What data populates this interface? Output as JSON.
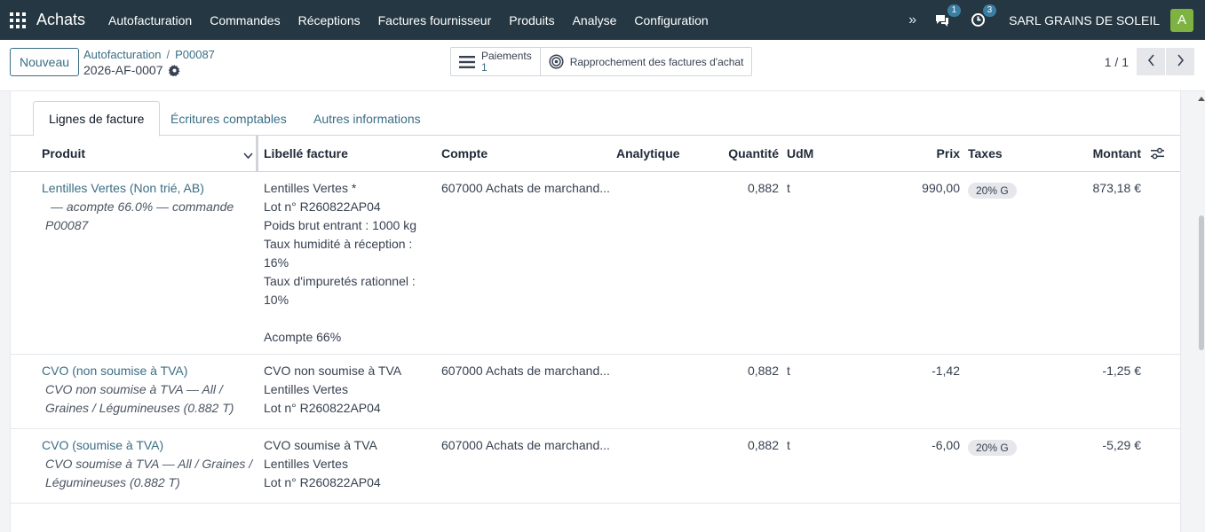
{
  "navbar": {
    "brand": "Achats",
    "menu": [
      "Autofacturation",
      "Commandes",
      "Réceptions",
      "Factures fournisseur",
      "Produits",
      "Analyse",
      "Configuration"
    ],
    "messages_count": "1",
    "activities_count": "3",
    "company": "SARL GRAINS DE SOLEIL",
    "avatar_letter": "A",
    "avatar_color": "#7fb341"
  },
  "control": {
    "new_label": "Nouveau",
    "breadcrumb_parent": "Autofacturation",
    "breadcrumb_sep": "/",
    "breadcrumb_current": "P00087",
    "record_name": "2026-AF-0007",
    "smart_payments_label": "Paiements",
    "smart_payments_count": "1",
    "smart_reconcile_label": "Rapprochement des factures d'achat",
    "pager": "1 / 1"
  },
  "tabs": [
    "Lignes de facture",
    "Écritures comptables",
    "Autres informations"
  ],
  "table": {
    "headers": {
      "product": "Produit",
      "label": "Libellé facture",
      "account": "Compte",
      "analytic": "Analytique",
      "quantity": "Quantité",
      "uom": "UdM",
      "price": "Prix",
      "taxes": "Taxes",
      "amount": "Montant"
    },
    "rows": [
      {
        "product": "Lentilles Vertes (Non trié, AB)",
        "product_desc": "— acompte 66.0% — commande P00087",
        "label_lines": [
          "Lentilles Vertes *",
          "Lot n° R260822AP04",
          "Poids brut entrant : 1000 kg",
          "Taux humidité à réception :",
          "16%",
          "Taux d'impuretés rationnel :",
          "10%",
          "",
          "Acompte 66%"
        ],
        "account": "607000 Achats de marchand...",
        "quantity": "0,882",
        "uom": "t",
        "price": "990,00",
        "tax": "20% G",
        "amount": "873,18 €"
      },
      {
        "product": "CVO (non soumise à TVA)",
        "product_desc": "CVO non soumise à TVA — All / Graines / Légumineuses (0.882 T)",
        "label_lines": [
          "CVO non soumise à TVA",
          "Lentilles Vertes",
          "Lot n° R260822AP04"
        ],
        "account": "607000 Achats de marchand...",
        "quantity": "0,882",
        "uom": "t",
        "price": "-1,42",
        "tax": "",
        "amount": "-1,25 €"
      },
      {
        "product": "CVO (soumise à TVA)",
        "product_desc": "CVO soumise à TVA — All / Graines / Légumineuses (0.882 T)",
        "label_lines": [
          "CVO soumise à TVA",
          "Lentilles Vertes",
          "Lot n° R260822AP04"
        ],
        "account": "607000 Achats de marchand...",
        "quantity": "0,882",
        "uom": "t",
        "price": "-6,00",
        "tax": "20% G",
        "amount": "-5,29 €"
      }
    ]
  }
}
